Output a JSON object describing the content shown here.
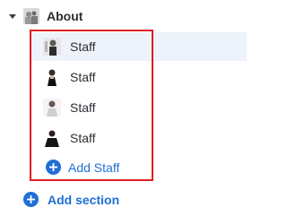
{
  "tree": {
    "header": {
      "label": "About",
      "expanded": true,
      "avatar_icon": "group-photo-thumbnail"
    },
    "items": [
      {
        "label": "Staff",
        "avatar_icon": "staff-photo-thumbnail",
        "selected": true
      },
      {
        "label": "Staff",
        "avatar_icon": "staff-photo-thumbnail",
        "selected": false
      },
      {
        "label": "Staff",
        "avatar_icon": "staff-photo-thumbnail",
        "selected": false
      },
      {
        "label": "Staff",
        "avatar_icon": "staff-photo-thumbnail",
        "selected": false
      }
    ],
    "add_staff_label": "Add Staff",
    "add_section_label": "Add section"
  },
  "colors": {
    "accent": "#1f6fd6",
    "highlight_border": "#e01b24",
    "selected_background": "#eef3fb",
    "text": "#2b2f33"
  }
}
